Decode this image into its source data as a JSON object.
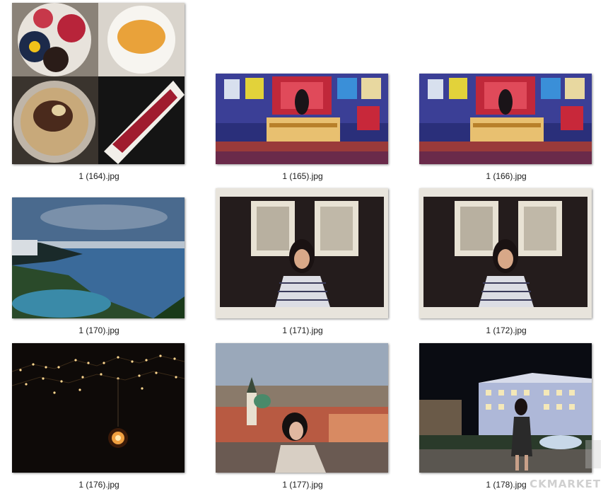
{
  "files": [
    {
      "name": "1 (164).jpg",
      "icon": "food-photo-thumbnail-icon"
    },
    {
      "name": "1 (165).jpg",
      "icon": "studio-stage-thumbnail-icon"
    },
    {
      "name": "1 (166).jpg",
      "icon": "studio-stage-thumbnail-icon"
    },
    {
      "name": "1 (170).jpg",
      "icon": "seaside-cliff-thumbnail-icon"
    },
    {
      "name": "1 (171).jpg",
      "icon": "portrait-thumbnail-icon"
    },
    {
      "name": "1 (172).jpg",
      "icon": "portrait-thumbnail-icon"
    },
    {
      "name": "1 (176).jpg",
      "icon": "night-lights-thumbnail-icon"
    },
    {
      "name": "1 (177).jpg",
      "icon": "city-portrait-thumbnail-icon"
    },
    {
      "name": "1 (178).jpg",
      "icon": "night-hotel-thumbnail-icon"
    }
  ],
  "watermark": "CKMARKET",
  "colors": {
    "background": "#ffffff",
    "caption_text": "#1a1a1a"
  }
}
